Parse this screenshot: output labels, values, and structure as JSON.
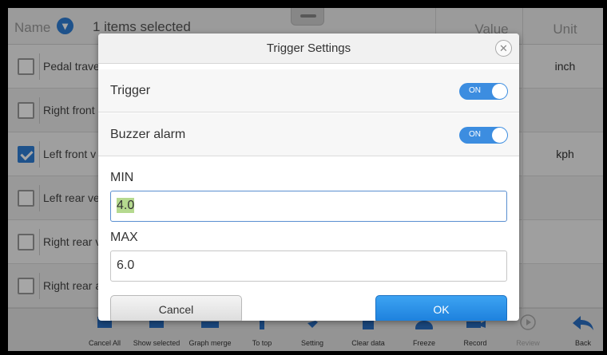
{
  "header": {
    "name_label": "Name",
    "selection": "1 items selected",
    "value_label": "Value",
    "unit_label": "Unit"
  },
  "rows": [
    {
      "label": "Pedal trave",
      "checked": false,
      "unit": "inch"
    },
    {
      "label": "Right front",
      "checked": false,
      "unit": ""
    },
    {
      "label": "Left front v",
      "checked": true,
      "unit": "kph"
    },
    {
      "label": "Left rear ve",
      "checked": false,
      "unit": ""
    },
    {
      "label": "Right rear v",
      "checked": false,
      "unit": ""
    },
    {
      "label": "Right rear a",
      "checked": false,
      "unit": ""
    }
  ],
  "toolbar": {
    "items": [
      {
        "label": "Cancel All",
        "icon": "cancel-all-icon"
      },
      {
        "label": "Show selected",
        "icon": "show-selected-icon"
      },
      {
        "label": "Graph merge",
        "icon": "graph-merge-icon"
      },
      {
        "label": "To top",
        "icon": "to-top-icon"
      },
      {
        "label": "Setting",
        "icon": "setting-icon"
      },
      {
        "label": "Clear data",
        "icon": "clear-data-icon"
      },
      {
        "label": "Freeze",
        "icon": "freeze-icon"
      },
      {
        "label": "Record",
        "icon": "record-icon"
      },
      {
        "label": "Review",
        "icon": "review-icon"
      },
      {
        "label": "Back",
        "icon": "back-icon"
      }
    ]
  },
  "dialog": {
    "title": "Trigger Settings",
    "close_symbol": "✕",
    "trigger_label": "Trigger",
    "trigger_state": "ON",
    "buzzer_label": "Buzzer alarm",
    "buzzer_state": "ON",
    "min_label": "MIN",
    "min_value": "4.0",
    "max_label": "MAX",
    "max_value": "6.0",
    "cancel_label": "Cancel",
    "ok_label": "OK"
  },
  "colors": {
    "accent": "#2f7fd6",
    "ok_button": "#1c7fdc",
    "highlight": "#b5d98f"
  }
}
